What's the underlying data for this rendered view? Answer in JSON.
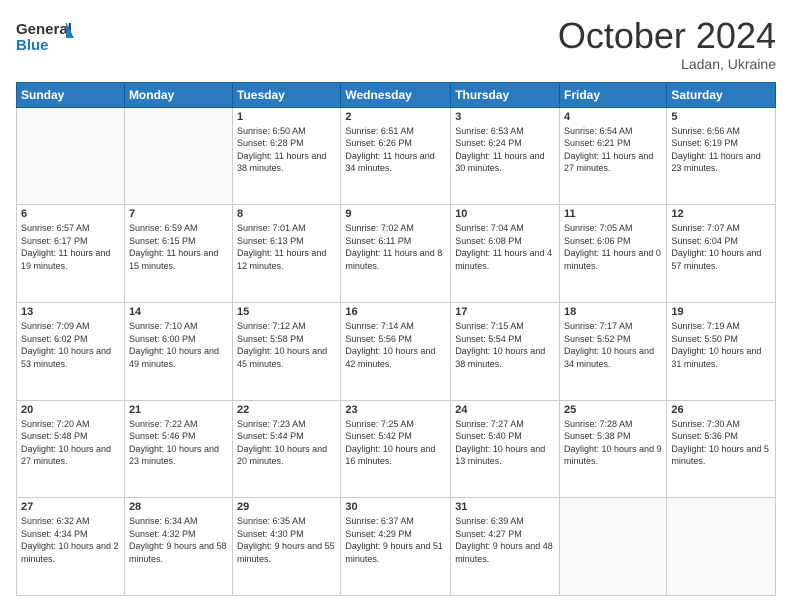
{
  "logo": {
    "line1": "General",
    "line2": "Blue"
  },
  "title": "October 2024",
  "subtitle": "Ladan, Ukraine",
  "days_of_week": [
    "Sunday",
    "Monday",
    "Tuesday",
    "Wednesday",
    "Thursday",
    "Friday",
    "Saturday"
  ],
  "weeks": [
    [
      {
        "day": "",
        "info": ""
      },
      {
        "day": "",
        "info": ""
      },
      {
        "day": "1",
        "info": "Sunrise: 6:50 AM\nSunset: 6:28 PM\nDaylight: 11 hours and 38 minutes."
      },
      {
        "day": "2",
        "info": "Sunrise: 6:51 AM\nSunset: 6:26 PM\nDaylight: 11 hours and 34 minutes."
      },
      {
        "day": "3",
        "info": "Sunrise: 6:53 AM\nSunset: 6:24 PM\nDaylight: 11 hours and 30 minutes."
      },
      {
        "day": "4",
        "info": "Sunrise: 6:54 AM\nSunset: 6:21 PM\nDaylight: 11 hours and 27 minutes."
      },
      {
        "day": "5",
        "info": "Sunrise: 6:56 AM\nSunset: 6:19 PM\nDaylight: 11 hours and 23 minutes."
      }
    ],
    [
      {
        "day": "6",
        "info": "Sunrise: 6:57 AM\nSunset: 6:17 PM\nDaylight: 11 hours and 19 minutes."
      },
      {
        "day": "7",
        "info": "Sunrise: 6:59 AM\nSunset: 6:15 PM\nDaylight: 11 hours and 15 minutes."
      },
      {
        "day": "8",
        "info": "Sunrise: 7:01 AM\nSunset: 6:13 PM\nDaylight: 11 hours and 12 minutes."
      },
      {
        "day": "9",
        "info": "Sunrise: 7:02 AM\nSunset: 6:11 PM\nDaylight: 11 hours and 8 minutes."
      },
      {
        "day": "10",
        "info": "Sunrise: 7:04 AM\nSunset: 6:08 PM\nDaylight: 11 hours and 4 minutes."
      },
      {
        "day": "11",
        "info": "Sunrise: 7:05 AM\nSunset: 6:06 PM\nDaylight: 11 hours and 0 minutes."
      },
      {
        "day": "12",
        "info": "Sunrise: 7:07 AM\nSunset: 6:04 PM\nDaylight: 10 hours and 57 minutes."
      }
    ],
    [
      {
        "day": "13",
        "info": "Sunrise: 7:09 AM\nSunset: 6:02 PM\nDaylight: 10 hours and 53 minutes."
      },
      {
        "day": "14",
        "info": "Sunrise: 7:10 AM\nSunset: 6:00 PM\nDaylight: 10 hours and 49 minutes."
      },
      {
        "day": "15",
        "info": "Sunrise: 7:12 AM\nSunset: 5:58 PM\nDaylight: 10 hours and 45 minutes."
      },
      {
        "day": "16",
        "info": "Sunrise: 7:14 AM\nSunset: 5:56 PM\nDaylight: 10 hours and 42 minutes."
      },
      {
        "day": "17",
        "info": "Sunrise: 7:15 AM\nSunset: 5:54 PM\nDaylight: 10 hours and 38 minutes."
      },
      {
        "day": "18",
        "info": "Sunrise: 7:17 AM\nSunset: 5:52 PM\nDaylight: 10 hours and 34 minutes."
      },
      {
        "day": "19",
        "info": "Sunrise: 7:19 AM\nSunset: 5:50 PM\nDaylight: 10 hours and 31 minutes."
      }
    ],
    [
      {
        "day": "20",
        "info": "Sunrise: 7:20 AM\nSunset: 5:48 PM\nDaylight: 10 hours and 27 minutes."
      },
      {
        "day": "21",
        "info": "Sunrise: 7:22 AM\nSunset: 5:46 PM\nDaylight: 10 hours and 23 minutes."
      },
      {
        "day": "22",
        "info": "Sunrise: 7:23 AM\nSunset: 5:44 PM\nDaylight: 10 hours and 20 minutes."
      },
      {
        "day": "23",
        "info": "Sunrise: 7:25 AM\nSunset: 5:42 PM\nDaylight: 10 hours and 16 minutes."
      },
      {
        "day": "24",
        "info": "Sunrise: 7:27 AM\nSunset: 5:40 PM\nDaylight: 10 hours and 13 minutes."
      },
      {
        "day": "25",
        "info": "Sunrise: 7:28 AM\nSunset: 5:38 PM\nDaylight: 10 hours and 9 minutes."
      },
      {
        "day": "26",
        "info": "Sunrise: 7:30 AM\nSunset: 5:36 PM\nDaylight: 10 hours and 5 minutes."
      }
    ],
    [
      {
        "day": "27",
        "info": "Sunrise: 6:32 AM\nSunset: 4:34 PM\nDaylight: 10 hours and 2 minutes."
      },
      {
        "day": "28",
        "info": "Sunrise: 6:34 AM\nSunset: 4:32 PM\nDaylight: 9 hours and 58 minutes."
      },
      {
        "day": "29",
        "info": "Sunrise: 6:35 AM\nSunset: 4:30 PM\nDaylight: 9 hours and 55 minutes."
      },
      {
        "day": "30",
        "info": "Sunrise: 6:37 AM\nSunset: 4:29 PM\nDaylight: 9 hours and 51 minutes."
      },
      {
        "day": "31",
        "info": "Sunrise: 6:39 AM\nSunset: 4:27 PM\nDaylight: 9 hours and 48 minutes."
      },
      {
        "day": "",
        "info": ""
      },
      {
        "day": "",
        "info": ""
      }
    ]
  ]
}
